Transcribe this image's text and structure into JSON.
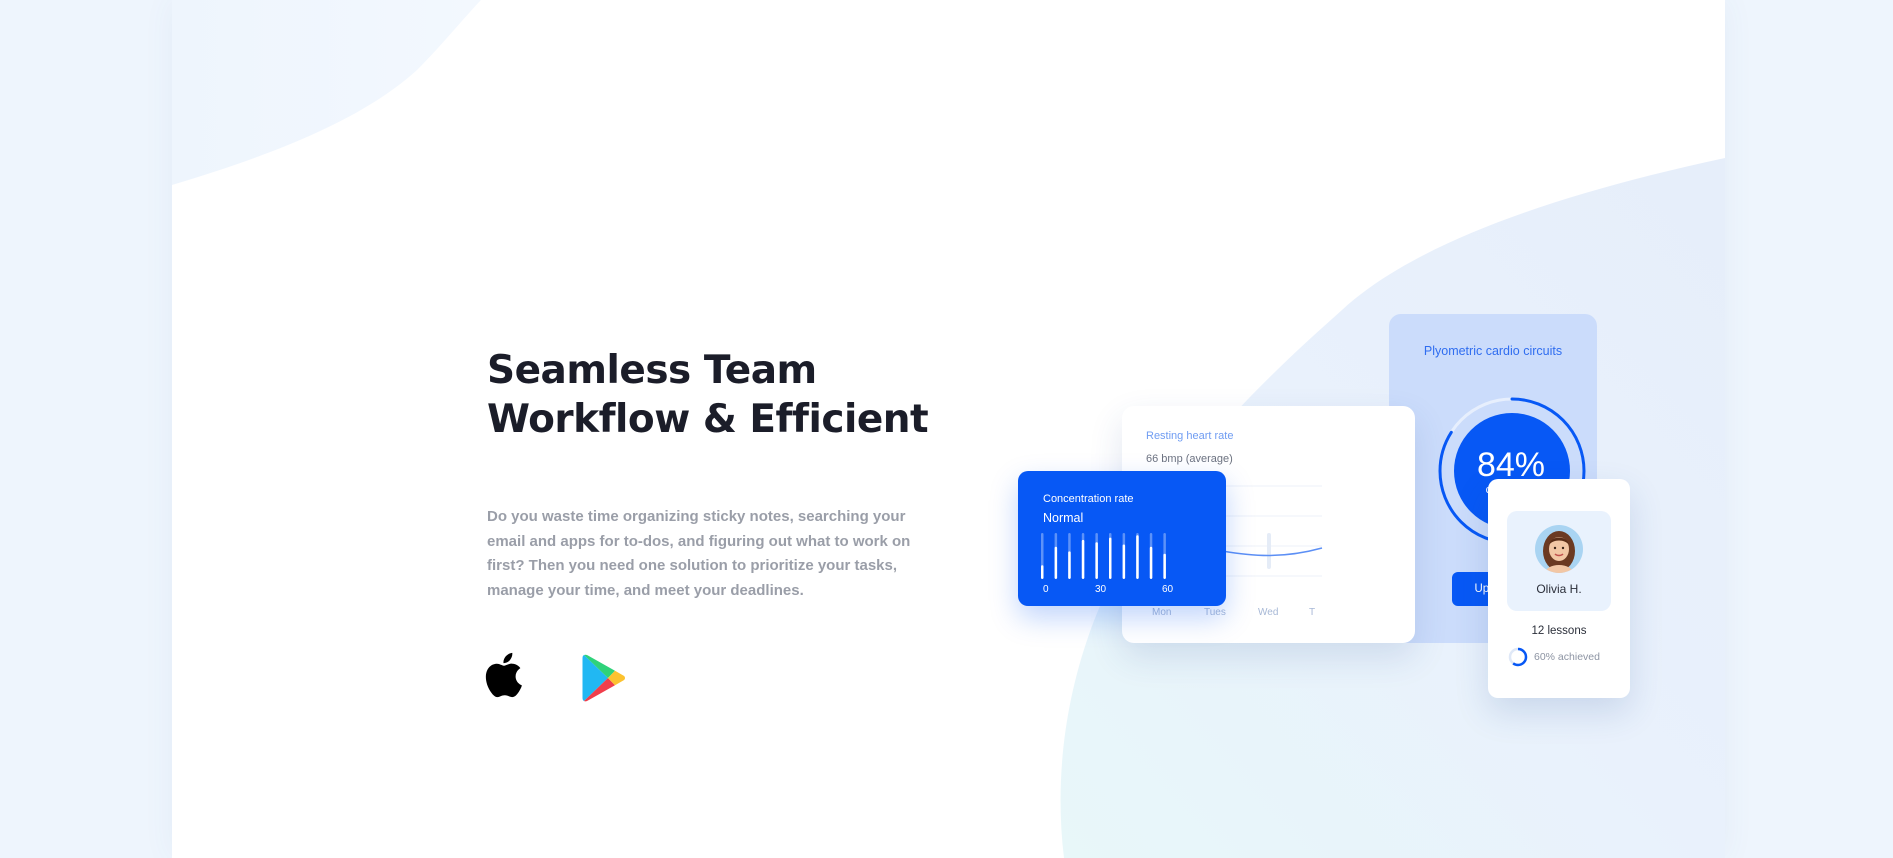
{
  "hero": {
    "title_line1": "Seamless Team",
    "title_line2": "Workflow & Efficient",
    "description": "Do you waste time organizing sticky notes, searching your email and apps for to-dos, and figuring out what to work on first? Then you need one solution to prioritize your tasks, manage your time, and meet your deadlines."
  },
  "stores": {
    "apple_icon": "apple-icon",
    "play_icon": "google-play-icon"
  },
  "dashboard": {
    "plyometric": {
      "title": "Plyometric cardio circuits",
      "percent": "84%",
      "percent_value": 0.84,
      "percent_label": "completed",
      "button_label": "Update training",
      "accent": "#0758f5"
    },
    "heart_rate": {
      "title": "Resting heart rate",
      "average": "66 bmp (average)",
      "days": [
        "Mon",
        "Tues",
        "Wed",
        "T"
      ]
    },
    "concentration": {
      "title": "Concentration rate",
      "status": "Normal",
      "ticks": [
        "0",
        "30",
        "60"
      ],
      "bar_levels": [
        0.3,
        0.7,
        0.6,
        0.85,
        0.8,
        0.9,
        0.75,
        0.95,
        0.7,
        0.55
      ]
    },
    "profile": {
      "name": "Olivia H.",
      "lessons": "12 lessons",
      "achieved": "60% achieved",
      "achieved_value": 0.6
    }
  },
  "colors": {
    "primary": "#0758f5",
    "heading": "#1b1d29",
    "body_text": "#9a9ea8",
    "light_panel": "#cbdcfb"
  }
}
